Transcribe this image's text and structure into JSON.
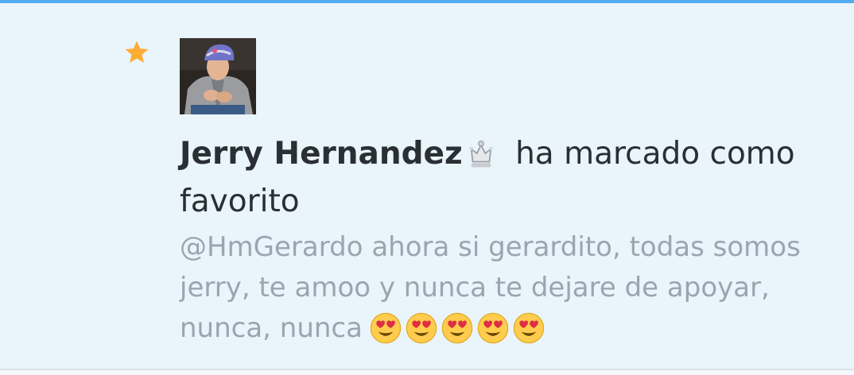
{
  "notification": {
    "type_icon": "star-icon",
    "user": {
      "name": "Jerry Hernandez",
      "badge_icon": "crown-icon"
    },
    "action_text": "ha marcado como favorito",
    "tweet": {
      "text": "@HmGerardo ahora si gerardito, todas somos jerry, te amoo y nunca te dejare de apoyar, nunca, nunca",
      "emojis": [
        "heart-eyes-icon",
        "heart-eyes-icon",
        "heart-eyes-icon",
        "heart-eyes-icon",
        "heart-eyes-icon"
      ]
    }
  },
  "colors": {
    "accent": "#55acee",
    "star": "#ffac33",
    "background": "#e9f4fb",
    "name_text": "#292f33",
    "tweet_text": "#99a6b0"
  }
}
